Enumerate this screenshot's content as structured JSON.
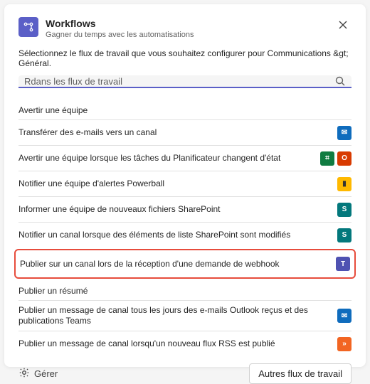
{
  "header": {
    "title": "Workflows",
    "subtitle": "Gagner du temps avec les automatisations"
  },
  "intro": "Sélectionnez le flux de travail que vous souhaitez configurer pour Communications &gt; Général.",
  "search": {
    "placeholder": "Rdans les flux de travail",
    "value": ""
  },
  "groups": [
    {
      "title": "Avertir une équipe",
      "items": [
        {
          "label": "Transférer des e-mails vers un canal",
          "icons": [
            "outlook"
          ]
        },
        {
          "label": "Avertir une équipe lorsque les tâches du Planificateur changent d'état",
          "icons": [
            "planner",
            "office"
          ]
        },
        {
          "label": "Notifier une équipe d'alertes Powerball",
          "icons": [
            "powerbi"
          ]
        },
        {
          "label": "Informer une équipe de nouveaux fichiers SharePoint",
          "icons": [
            "sharepoint"
          ]
        },
        {
          "label": "Notifier un canal lorsque des éléments de liste SharePoint sont modifiés",
          "icons": [
            "sharepoint"
          ]
        },
        {
          "label": "Publier sur un canal lors de la réception d'une demande de webhook",
          "icons": [
            "teams"
          ],
          "highlighted": true
        }
      ]
    },
    {
      "title": "Publier un résumé",
      "items": [
        {
          "label": "Publier un message de canal tous les jours des e-mails Outlook reçus et des publications Teams",
          "icons": [
            "outlook"
          ]
        },
        {
          "label": "Publier un message de canal lorsqu'un nouveau flux RSS est publié",
          "icons": [
            "rss"
          ]
        }
      ]
    }
  ],
  "footer": {
    "manage": "Gérer",
    "more": "Autres flux de travail"
  },
  "iconMap": {
    "outlook": {
      "cls": "c-blue",
      "glyph": "✉"
    },
    "planner": {
      "cls": "c-green",
      "glyph": "⌗"
    },
    "office": {
      "cls": "c-orange",
      "glyph": "O"
    },
    "powerbi": {
      "cls": "c-yellow",
      "glyph": "▮"
    },
    "sharepoint": {
      "cls": "c-teal",
      "glyph": "S"
    },
    "teams": {
      "cls": "c-purple",
      "glyph": "T"
    },
    "rss": {
      "cls": "c-rss",
      "glyph": "»"
    }
  }
}
